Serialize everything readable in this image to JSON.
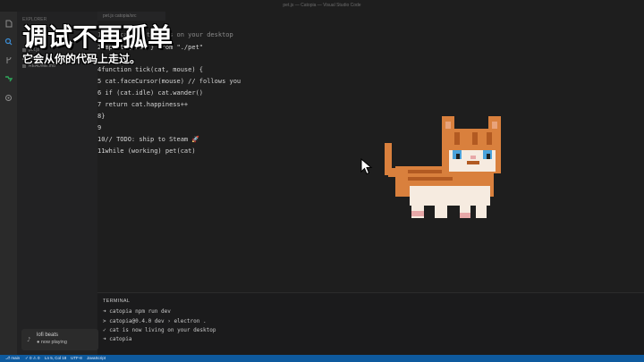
{
  "window": {
    "title": "pet.js — Catopia — Visual Studio Code"
  },
  "activity_icons": [
    "files-icon",
    "search-icon",
    "source-control-icon",
    "run-debug-icon",
    "extensions-icon"
  ],
  "sidebar": {
    "header": "EXPLORER",
    "items": [
      {
        "label": "pet.js"
      },
      {
        "label": "ideas"
      },
      {
        "label": "README.md"
      }
    ]
  },
  "editor": {
    "tab": "pet.js catopia/src",
    "lines": [
      {
        "text": "1// a cat that lives on your desktop",
        "comment": true
      },
      {
        "text": "2import { Pet } from \"./pet\"",
        "comment": false
      },
      {
        "text": "4function tick(cat, mouse) {",
        "comment": false
      },
      {
        "text": "5 cat.faceCursor(mouse) // follows you",
        "comment": false
      },
      {
        "text": "6 if (cat.idle) cat.wander()",
        "comment": false
      },
      {
        "text": "7 return cat.happiness++",
        "comment": false
      },
      {
        "text": "8}",
        "comment": false
      },
      {
        "text": "9",
        "comment": false
      },
      {
        "text": "10// TODO: ship to Steam 🚀",
        "comment": false
      },
      {
        "text": "11while (working) pet(cat)",
        "comment": false
      }
    ]
  },
  "overlay": {
    "title": "调试不再孤单",
    "subtitle": "它会从你的代码上走过。"
  },
  "terminal": {
    "title": "TERMINAL",
    "lines": [
      {
        "text": "➜ catopia npm run dev"
      },
      {
        "text": "> catopia@0.4.0 dev › electron ."
      },
      {
        "text": "✓ cat is now living on your desktop"
      },
      {
        "text": "➜ catopia"
      }
    ]
  },
  "music": {
    "title": "lofi beats",
    "subtitle": "● now playing",
    "icon": "music-note-icon"
  },
  "statusbar": {
    "branch": "⎇ main",
    "problems": "✓ 0 ⚠ 0",
    "position": "Ln 5, Col 18",
    "encoding": "UTF-8",
    "language": "JavaScript"
  },
  "colors": {
    "accent": "#0e5a9e",
    "cat_orange": "#d9803d",
    "cat_cream": "#f6ebe0",
    "cat_eye": "#4ba3dc"
  }
}
